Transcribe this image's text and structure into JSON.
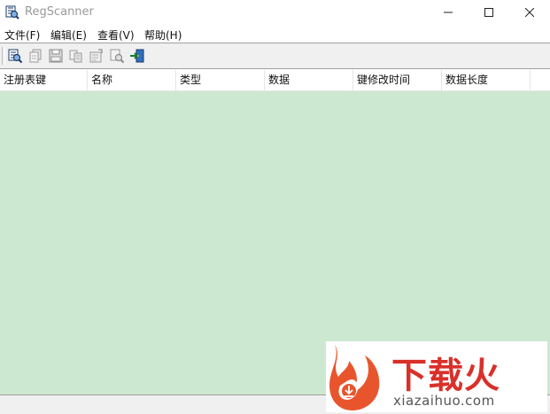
{
  "window": {
    "title": "RegScanner",
    "controls": {
      "minimize": "—",
      "maximize": "☐",
      "close": "✕"
    }
  },
  "menu": [
    {
      "label": "文件(F)"
    },
    {
      "label": "编辑(E)"
    },
    {
      "label": "查看(V)"
    },
    {
      "label": "帮助(H)"
    }
  ],
  "toolbar": {
    "buttons": [
      {
        "icon": "new-scan-icon"
      },
      {
        "icon": "copy-icon"
      },
      {
        "icon": "save-icon"
      },
      {
        "icon": "copy-items-icon"
      },
      {
        "icon": "properties-icon"
      },
      {
        "icon": "find-icon"
      },
      {
        "icon": "exit-icon"
      }
    ]
  },
  "table": {
    "columns": [
      "注册表键",
      "名称",
      "类型",
      "数据",
      "键修改时间",
      "数据长度"
    ],
    "rows": [],
    "background": "#cde8d0"
  },
  "watermark": {
    "brand": "下载火",
    "url": "xiazaihuo.com",
    "color": "#d9302a"
  }
}
